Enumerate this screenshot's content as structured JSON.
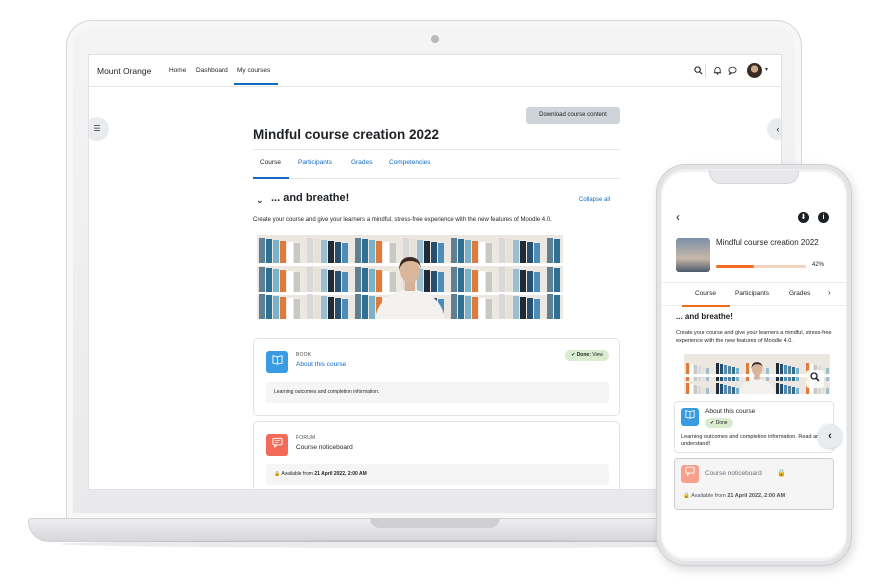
{
  "navbar": {
    "brand": "Mount Orange",
    "links": [
      "Home",
      "Dashboard",
      "My courses"
    ],
    "active_link": "My courses"
  },
  "course": {
    "download_label": "Download course content",
    "title": "Mindful course creation 2022",
    "tabs": [
      "Course",
      "Participants",
      "Grades",
      "Competencies"
    ],
    "active_tab": "Course",
    "section_title": "... and breathe!",
    "collapse_all": "Collapse all",
    "section_summary": "Create your course and give your learners a mindful, stress-free experience with the new features of Moodle 4.0.",
    "activities": [
      {
        "type": "BOOK",
        "name": "About this course",
        "done_bold": "Done:",
        "done_rest": " View",
        "info": "Learning outcomes and completion information."
      },
      {
        "type": "FORUM",
        "name": "Course noticeboard",
        "available_prefix": "Available from ",
        "available_date": "21 April 2022, 2:00 AM"
      }
    ]
  },
  "phone": {
    "course_title": "Mindful course creation 2022",
    "progress_percent": 42,
    "progress_label": "42%",
    "tabs": [
      "Course",
      "Participants",
      "Grades"
    ],
    "active_tab": "Course",
    "section_title": "... and breathe!",
    "section_summary": "Create your course and give your learners a mindful, stress-free experience with the new features of Moodle 4.0.",
    "book": {
      "name": "About this course",
      "done_label": "Done",
      "info": "Learning outcomes and completion information. Read and understand!"
    },
    "forum": {
      "name": "Course noticeboard",
      "available_prefix": "Available from ",
      "available_date": "21 April 2022, 2:00 AM"
    }
  },
  "colors": {
    "link_blue": "#0f6cbf",
    "book_blue": "#399be2",
    "forum_red": "#f36b58",
    "progress_orange": "#f26b21",
    "done_green_bg": "#d9eccf"
  },
  "icons": {
    "search": "search-icon",
    "bell": "bell-icon",
    "chat": "chat-icon",
    "drawer": "list-icon",
    "chevron": "chevron-left-icon",
    "book": "book-icon",
    "forum": "forum-icon",
    "lock": "lock-icon",
    "check": "check-icon",
    "download": "download-icon",
    "info": "info-icon",
    "zoom": "zoom-icon"
  }
}
